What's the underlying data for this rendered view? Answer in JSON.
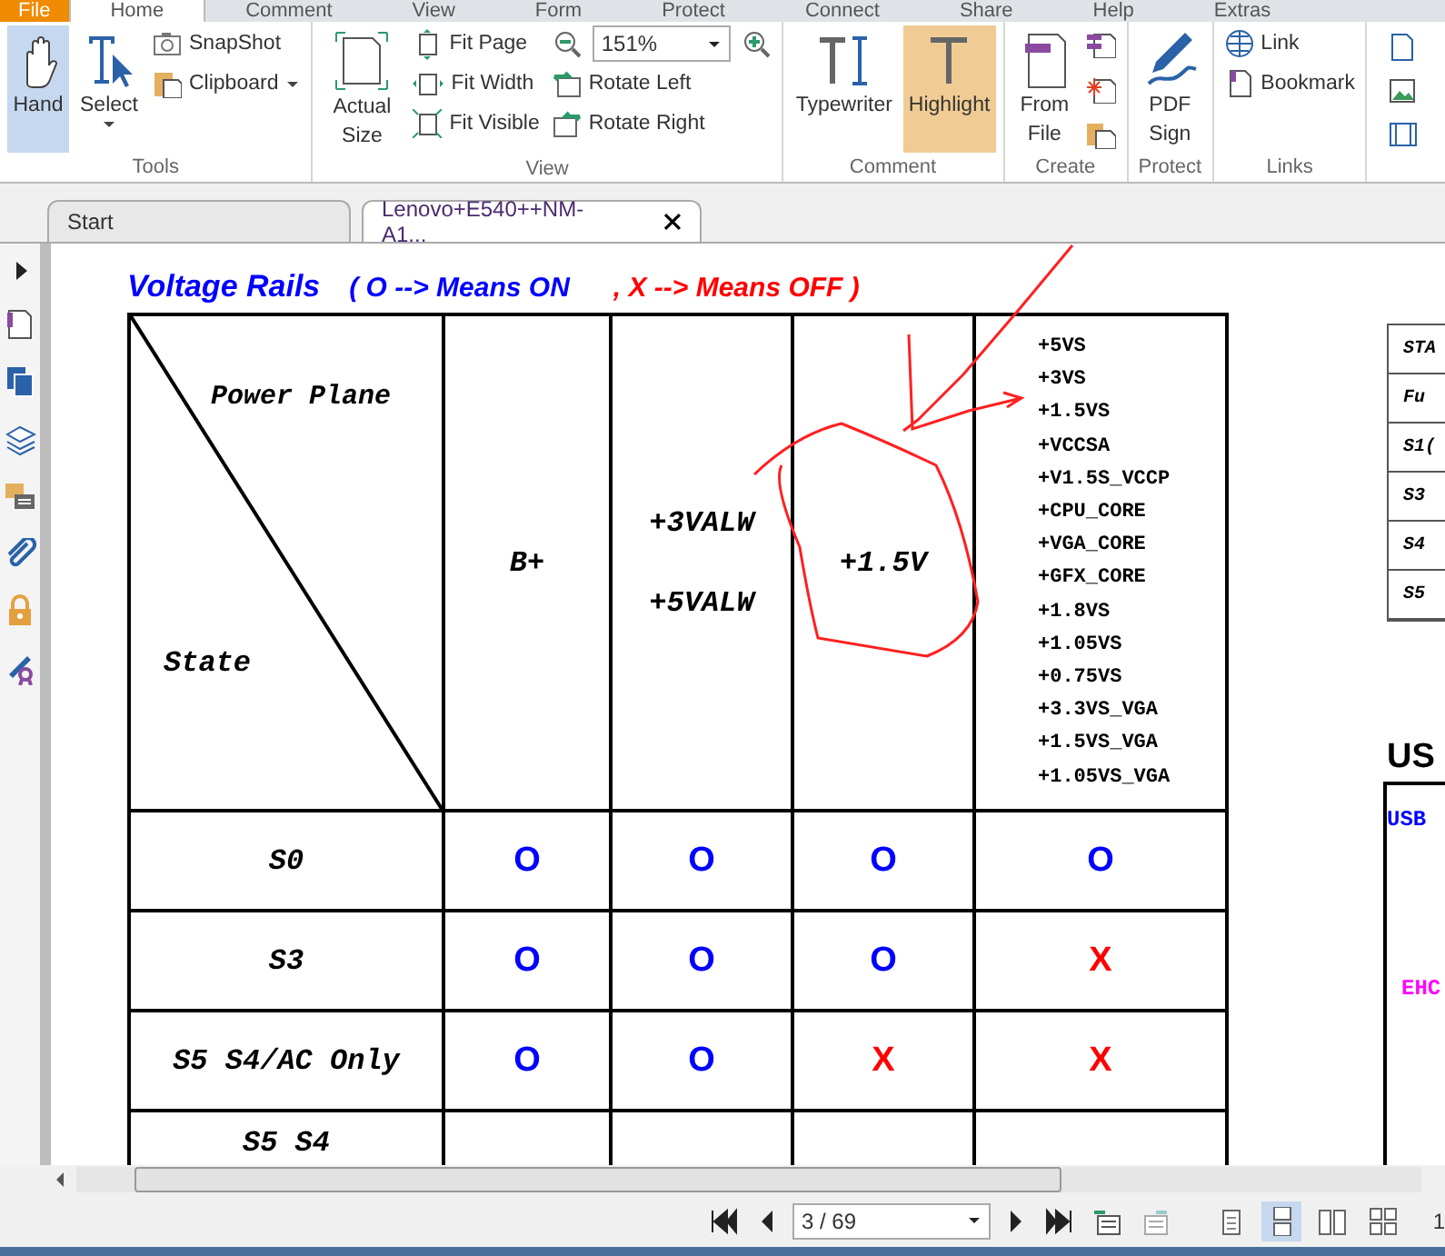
{
  "menu_tabs": [
    {
      "label": "File",
      "kind": "file",
      "selected": false
    },
    {
      "label": "Home",
      "kind": "tab",
      "selected": true
    },
    {
      "label": "Comment",
      "kind": "tab",
      "selected": false
    },
    {
      "label": "View",
      "kind": "tab",
      "selected": false
    },
    {
      "label": "Form",
      "kind": "tab",
      "selected": false
    },
    {
      "label": "Protect",
      "kind": "tab",
      "selected": false
    },
    {
      "label": "Connect",
      "kind": "tab",
      "selected": false
    },
    {
      "label": "Share",
      "kind": "tab",
      "selected": false
    },
    {
      "label": "Help",
      "kind": "tab",
      "selected": false
    },
    {
      "label": "Extras",
      "kind": "tab",
      "selected": false
    }
  ],
  "ribbon": {
    "tools": {
      "label": "Tools",
      "hand": {
        "label": "Hand",
        "selected": true
      },
      "select": {
        "label": "Select"
      },
      "snapshot": {
        "label": "SnapShot"
      },
      "clipboard": {
        "label": "Clipboard"
      }
    },
    "view": {
      "label": "View",
      "actual_size": "Actual Size",
      "fit_page": "Fit Page",
      "fit_width": "Fit Width",
      "fit_visible": "Fit Visible",
      "zoom": "151%",
      "rotate_left": "Rotate Left",
      "rotate_right": "Rotate Right"
    },
    "comment": {
      "label": "Comment",
      "typewriter": {
        "label": "Typewriter",
        "selected": false
      },
      "highlight": {
        "label": "Highlight",
        "selected": true
      }
    },
    "create": {
      "label": "Create",
      "from_file": "From File"
    },
    "protect": {
      "label": "Protect",
      "pdf_sign": "PDF Sign"
    },
    "links": {
      "label": "Links",
      "link": "Link",
      "bookmark": "Bookmark"
    }
  },
  "doc_tabs": [
    {
      "label": "Start",
      "selected": false
    },
    {
      "label": "Lenovo+E540++NM-A1...",
      "selected": true
    }
  ],
  "document": {
    "title": "Voltage Rails",
    "legend_on": "( O --> Means ON",
    "legend_off": ", X --> Means OFF )",
    "header": {
      "power_plane": "Power Plane",
      "state": "State",
      "columns": [
        [
          "B+"
        ],
        [
          "+3VALW",
          "+5VALW"
        ],
        [
          "+1.5V"
        ],
        [
          "+5VS",
          "+3VS",
          "+1.5VS",
          "+VCCSA",
          "+V1.5S_VCCP",
          "+CPU_CORE",
          "+VGA_CORE",
          "+GFX_CORE",
          "+1.8VS",
          "+1.05VS",
          "+0.75VS",
          "+3.3VS_VGA",
          "+1.5VS_VGA",
          "+1.05VS_VGA"
        ]
      ]
    },
    "rows": [
      {
        "state": "S0",
        "cells": [
          {
            "text": "O",
            "kind": "on"
          },
          {
            "text": "O",
            "kind": "on"
          },
          {
            "text": "O",
            "kind": "on"
          },
          {
            "text": "O",
            "kind": "on"
          }
        ]
      },
      {
        "state": "S3",
        "cells": [
          {
            "text": "O",
            "kind": "on"
          },
          {
            "text": "O",
            "kind": "on"
          },
          {
            "text": "O",
            "kind": "on"
          },
          {
            "text": "X",
            "kind": "off"
          }
        ]
      },
      {
        "state": "S5 S4/AC Only",
        "cells": [
          {
            "text": "O",
            "kind": "on"
          },
          {
            "text": "O",
            "kind": "on"
          },
          {
            "text": "X",
            "kind": "off"
          },
          {
            "text": "X",
            "kind": "off"
          }
        ]
      },
      {
        "state": "S5 S4",
        "cells": []
      }
    ],
    "side_table": [
      "STA",
      "Fu",
      "S1(",
      "S3",
      "S4",
      "S5"
    ],
    "usb_heading": "US",
    "usb_label": "USB",
    "ehc_label": "EHC"
  },
  "status_bar": {
    "page": "3 / 69",
    "view_modes": [
      {
        "kind": "single",
        "selected": false
      },
      {
        "kind": "continuous",
        "selected": true
      },
      {
        "kind": "facing",
        "selected": false
      },
      {
        "kind": "cover",
        "selected": false
      }
    ],
    "edge_text": "1"
  }
}
